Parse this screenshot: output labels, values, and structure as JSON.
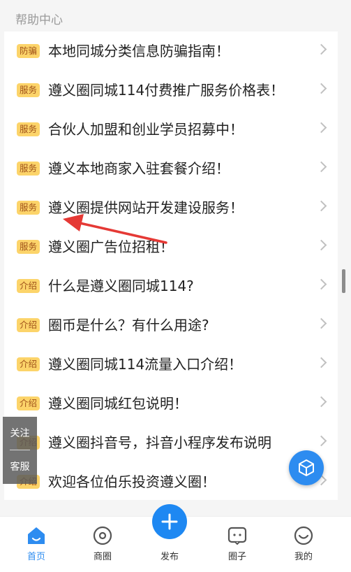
{
  "header": {
    "section_title": "帮助中心"
  },
  "items": [
    {
      "tag": "防骗",
      "title": "本地同城分类信息防骗指南！"
    },
    {
      "tag": "服务",
      "title": "遵义圈同城114付费推广服务价格表！"
    },
    {
      "tag": "服务",
      "title": "合伙人加盟和创业学员招募中！"
    },
    {
      "tag": "服务",
      "title": "遵义本地商家入驻套餐介绍！"
    },
    {
      "tag": "服务",
      "title": "遵义圈提供网站开发建设服务！"
    },
    {
      "tag": "服务",
      "title": "遵义圈广告位招租！"
    },
    {
      "tag": "介绍",
      "title": "什么是遵义圈同城114?"
    },
    {
      "tag": "介绍",
      "title": "圈币是什么？有什么用途?"
    },
    {
      "tag": "介绍",
      "title": "遵义圈同城114流量入口介绍！"
    },
    {
      "tag": "介绍",
      "title": "遵义圈同城红包说明！"
    },
    {
      "tag": "介绍",
      "title": "遵义圈抖音号，抖音小程序发布说明"
    },
    {
      "tag": "介绍",
      "title": "欢迎各位伯乐投资遵义圈！"
    }
  ],
  "float_panel": {
    "follow": "关注",
    "service": "客服"
  },
  "tabbar": {
    "home": "首页",
    "shop": "商圈",
    "publish": "发布",
    "circle": "圈子",
    "mine": "我的"
  },
  "colors": {
    "accent": "#2d8cf0",
    "tag_bg": "#fcd46a",
    "tag_text": "#a0521a",
    "arrow": "#e53935"
  }
}
